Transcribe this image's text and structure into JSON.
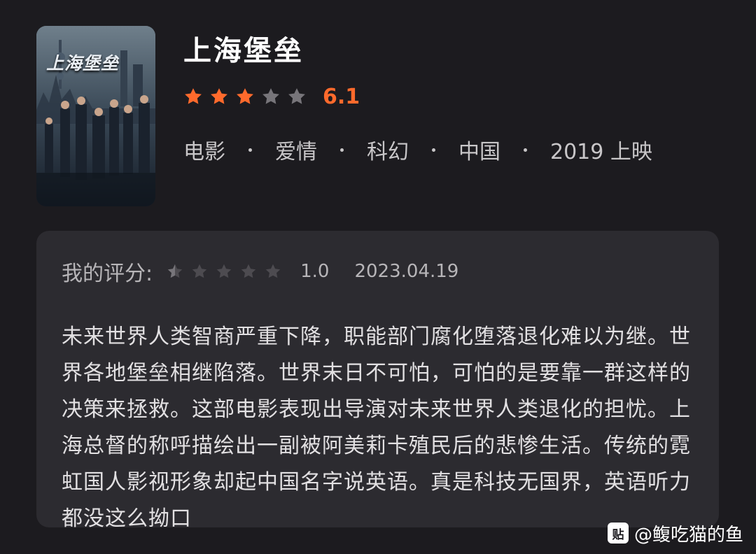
{
  "movie": {
    "poster_title": "上海堡垒",
    "title": "上海堡垒",
    "rating": {
      "score_text": "6.1",
      "stars_filled": 3,
      "stars_total": 5,
      "star_color": "#ff6a2c",
      "star_empty_color": "#77757a"
    },
    "meta": [
      "电影",
      "爱情",
      "科幻",
      "中国",
      "2019 上映"
    ]
  },
  "review": {
    "label": "我的评分:",
    "stars_filled": 0.5,
    "stars_total": 5,
    "score_text": "1.0",
    "date": "2023.04.19",
    "text": "未来世界人类智商严重下降，职能部门腐化堕落退化难以为继。世界各地堡垒相继陷落。世界末日不可怕，可怕的是要靠一群这样的决策来拯救。这部电影表现出导演对未来世界人类退化的担忧。上海总督的称呼描绘出一副被阿美莉卡殖民后的悲惨生活。传统的霓虹国人影视形象却起中国名字说英语。真是科技无国界，英语听力都没这么拗口"
  },
  "watermark": {
    "logo_text": "贴",
    "handle": "@鳆吃猫的鱼"
  }
}
